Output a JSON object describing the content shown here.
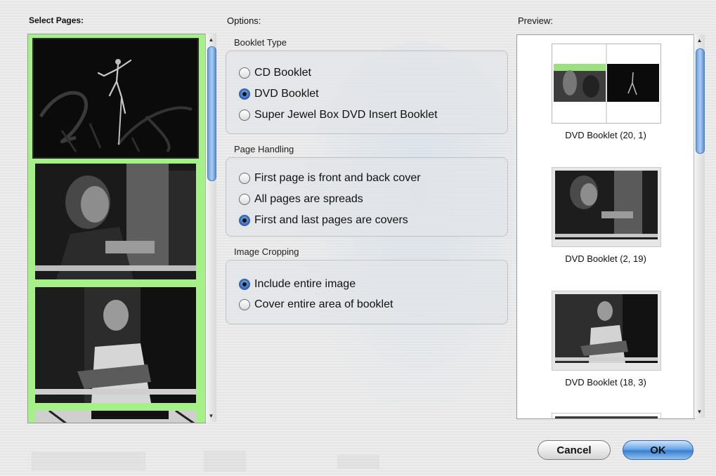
{
  "labels": {
    "select_pages": "Select Pages:",
    "options": "Options:",
    "preview": "Preview:"
  },
  "groups": {
    "booklet_type": {
      "title": "Booklet Type",
      "options": [
        "CD Booklet",
        "DVD Booklet",
        "Super Jewel Box DVD Insert Booklet"
      ],
      "selected": "DVD Booklet"
    },
    "page_handling": {
      "title": "Page Handling",
      "options": [
        "First page is front and back cover",
        "All pages are spreads",
        "First and last pages are covers"
      ],
      "selected": "First and last pages are covers"
    },
    "image_cropping": {
      "title": "Image Cropping",
      "options": [
        "Include entire image",
        "Cover entire area of booklet"
      ],
      "selected": "Include entire image"
    }
  },
  "preview_items": [
    {
      "caption": "DVD Booklet (20, 1)"
    },
    {
      "caption": "DVD Booklet (2, 19)"
    },
    {
      "caption": "DVD Booklet (18, 3)"
    }
  ],
  "buttons": {
    "cancel": "Cancel",
    "ok": "OK"
  },
  "colors": {
    "selection_green": "#a6f08a",
    "accent_blue": "#3b7fd0"
  },
  "icons": [
    "scroll-up-arrow-icon",
    "scroll-down-arrow-icon"
  ]
}
